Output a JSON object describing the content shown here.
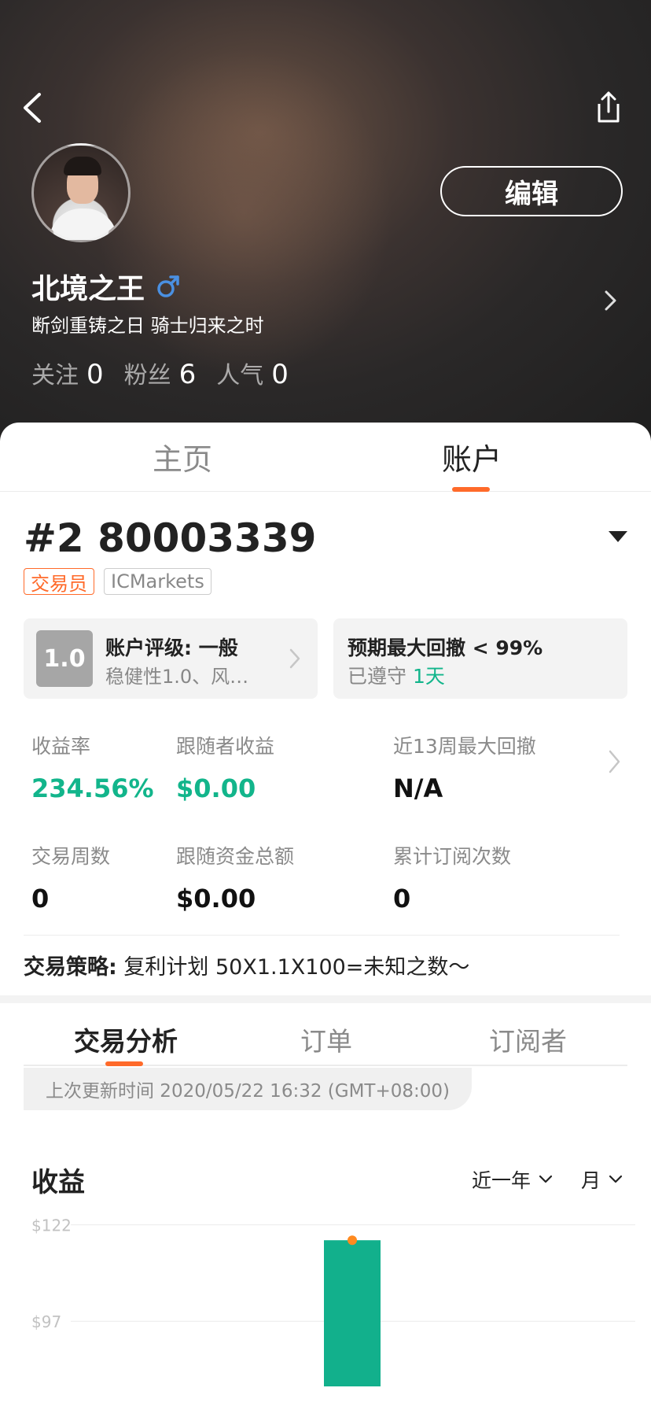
{
  "header": {
    "username": "北境之王",
    "bio": "断剑重铸之日 骑士归来之时",
    "edit_label": "编辑",
    "stats": [
      {
        "label": "关注",
        "value": "0"
      },
      {
        "label": "粉丝",
        "value": "6"
      },
      {
        "label": "人气",
        "value": "0"
      }
    ]
  },
  "tabs": {
    "home": "主页",
    "account": "账户"
  },
  "account": {
    "number": "#2 80003339",
    "tags": [
      "交易员",
      "ICMarkets"
    ],
    "rating": {
      "badge": "1.0",
      "title": "账户评级: 一般",
      "subtitle": "稳健性1.0、风…"
    },
    "drawdown": {
      "title": "预期最大回撤 < 99%",
      "kept_prefix": "已遵守",
      "kept_value": "1天"
    },
    "metrics": [
      {
        "label": "收益率",
        "value": "234.56%"
      },
      {
        "label": "跟随者收益",
        "value": "$0.00"
      },
      {
        "label": "近13周最大回撤",
        "value": "N/A"
      },
      {
        "label": "交易周数",
        "value": "0"
      },
      {
        "label": "跟随资金总额",
        "value": "$0.00"
      },
      {
        "label": "累计订阅次数",
        "value": "0"
      }
    ],
    "strategy_label": "交易策略:",
    "strategy_text": "复利计划 50X1.1X100=未知之数～"
  },
  "analysis": {
    "tabs": [
      "交易分析",
      "订单",
      "订阅者"
    ],
    "updated": "上次更新时间 2020/05/22 16:32 (GMT+08:00)",
    "profit_title": "收益",
    "range_select": "近一年",
    "unit_select": "月"
  },
  "colors": {
    "accent": "#ff6a2a",
    "positive": "#12b58b",
    "bar": "#12b08c",
    "gender": "#4a90e2"
  },
  "chart_data": {
    "type": "bar",
    "categories": [
      ""
    ],
    "values": [
      118
    ],
    "ytick_labels": [
      "$122",
      "$97"
    ],
    "yticks": [
      122,
      97
    ],
    "ylim": [
      74,
      126
    ],
    "xlabel": "",
    "ylabel": "",
    "grid": true,
    "marker_color": "#ff8a1f"
  }
}
